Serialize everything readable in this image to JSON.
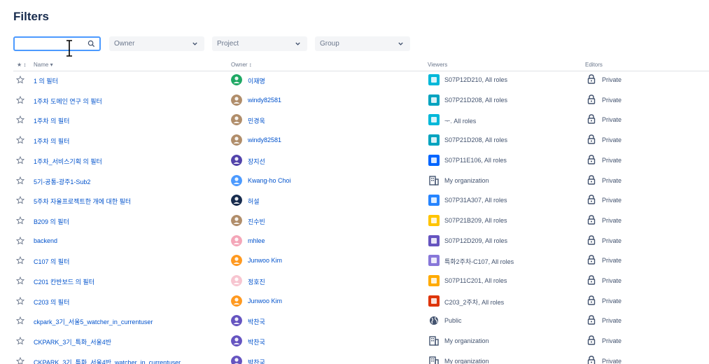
{
  "page": {
    "title": "Filters"
  },
  "search": {
    "placeholder": "",
    "value": ""
  },
  "dropdowns": {
    "owner": "Owner",
    "project": "Project",
    "group": "Group"
  },
  "columns": {
    "star": "★ ↕",
    "name": "Name ▾",
    "owner": "Owner ↕",
    "viewers": "Viewers",
    "editors": "Editors"
  },
  "colors": {
    "link": "#0052cc",
    "focus": "#4c9aff",
    "muted": "#6b778c"
  },
  "rows": [
    {
      "name": "1 의 필터",
      "owner": "이재명",
      "owner_avatar": "green-person-avatar",
      "viewer": "S07P12D210, All roles",
      "viewer_icon": "project-icon-cyan",
      "editor": "Private"
    },
    {
      "name": "1주차 도메인 연구 의 필터",
      "owner": "windy82581",
      "owner_avatar": "photo-avatar",
      "viewer": "S07P21D208, All roles",
      "viewer_icon": "project-icon-notepad",
      "editor": "Private"
    },
    {
      "name": "1주차 의 필터",
      "owner": "민경욱",
      "owner_avatar": "photo-avatar",
      "viewer": "ᅮ. All roles",
      "viewer_icon": "project-icon-cyan",
      "editor": "Private"
    },
    {
      "name": "1주차 의 필터",
      "owner": "windy82581",
      "owner_avatar": "photo-avatar",
      "viewer": "S07P21D208, All roles",
      "viewer_icon": "project-icon-notepad",
      "editor": "Private"
    },
    {
      "name": "1주차_서비스기획 의 필터",
      "owner": "장지선",
      "owner_avatar": "purple-avatar",
      "viewer": "S07P11E106, All roles",
      "viewer_icon": "project-icon-blue",
      "editor": "Private"
    },
    {
      "name": "5기-공통-광주1-Sub2",
      "owner": "Kwang-ho Choi",
      "owner_avatar": "blue-person-avatar",
      "viewer": "My organization",
      "viewer_icon": "building-icon",
      "editor": "Private"
    },
    {
      "name": "5주차 자율프로젝트한 개에 대한 필터",
      "owner": "허설",
      "owner_avatar": "dark-person-avatar",
      "viewer": "S07P31A307, All roles",
      "viewer_icon": "project-icon-cloud",
      "editor": "Private"
    },
    {
      "name": "B209 의 필터",
      "owner": "진수빈",
      "owner_avatar": "photo-avatar",
      "viewer": "S07P21B209, All roles",
      "viewer_icon": "project-icon-yellow",
      "editor": "Private"
    },
    {
      "name": "backend",
      "owner": "mhlee",
      "owner_avatar": "pink-avatar",
      "viewer": "S07P12D209, All roles",
      "viewer_icon": "project-icon-purple",
      "editor": "Private"
    },
    {
      "name": "C107 의 필터",
      "owner": "Junwoo Kim",
      "owner_avatar": "orange-jk-avatar",
      "viewer": "특화2주차-C107, All roles",
      "viewer_icon": "project-icon-purple-flag",
      "editor": "Private"
    },
    {
      "name": "C201 칸반보드 의 필터",
      "owner": "정호진",
      "owner_avatar": "pink-flower-avatar",
      "viewer": "S07P11C201, All roles",
      "viewer_icon": "project-icon-yellow-red",
      "editor": "Private"
    },
    {
      "name": "C203 의 필터",
      "owner": "Junwoo Kim",
      "owner_avatar": "orange-jk-avatar",
      "viewer": "C203_2주차, All roles",
      "viewer_icon": "project-icon-red",
      "editor": "Private"
    },
    {
      "name": "ckpark_3기_서울5_watcher_in_currentuser",
      "owner": "박찬국",
      "owner_avatar": "purple-person-avatar",
      "viewer": "Public",
      "viewer_icon": "globe-icon",
      "editor": "Private"
    },
    {
      "name": "CKPARK_3기_특화_서울4반",
      "owner": "박찬국",
      "owner_avatar": "purple-person-avatar",
      "viewer": "My organization",
      "viewer_icon": "building-icon",
      "editor": "Private"
    },
    {
      "name": "CKPARK_3기_특화_서울4반_watcher_in_currentuser",
      "owner": "박찬국",
      "owner_avatar": "purple-person-avatar",
      "viewer": "My organization",
      "viewer_icon": "building-icon",
      "editor": "Private"
    }
  ]
}
